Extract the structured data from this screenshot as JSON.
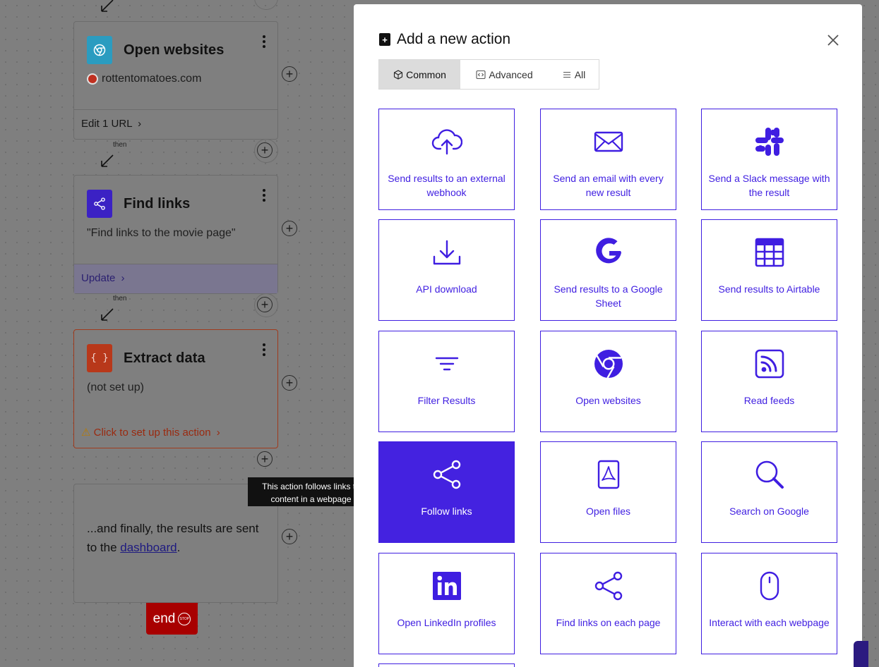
{
  "canvas": {
    "cards": [
      {
        "title": "Open websites",
        "subtitle": "rottentomatoes.com",
        "footer": "Edit 1 URL",
        "badge_color": "#2b9cc0"
      },
      {
        "title": "Find links",
        "subtitle": "\"Find links to the movie page\"",
        "footer": "Update",
        "badge_color": "#3b21c4"
      },
      {
        "title": "Extract data",
        "subtitle": "(not set up)",
        "footer": "Click to set up this action",
        "badge_color": "#b8381a",
        "badge_glyph": "{ }"
      }
    ],
    "then_label": "then",
    "final_text_before": "...and finally, the results are sent to the ",
    "final_link": "dashboard",
    "final_text_after": ".",
    "end_label": "end",
    "stop_label": "STOP",
    "tooltip": "This action follows links to content in a webpage"
  },
  "modal": {
    "title": "Add a new action",
    "plus_glyph": "+",
    "tabs": [
      {
        "label": "Common",
        "active": true
      },
      {
        "label": "Advanced",
        "active": false
      },
      {
        "label": "All",
        "active": false
      }
    ],
    "accent_color": "#3f1ee1",
    "actions": [
      {
        "label": "Send results to an external webhook",
        "icon": "cloud-upload-icon"
      },
      {
        "label": "Send an email with every new result",
        "icon": "mail-icon"
      },
      {
        "label": "Send a Slack message with the result",
        "icon": "slack-icon"
      },
      {
        "label": "API download",
        "icon": "download-icon"
      },
      {
        "label": "Send results to a Google Sheet",
        "icon": "google-icon"
      },
      {
        "label": "Send results to Airtable",
        "icon": "table-grid-icon"
      },
      {
        "label": "Filter Results",
        "icon": "filter-icon"
      },
      {
        "label": "Open websites",
        "icon": "chrome-icon"
      },
      {
        "label": "Read feeds",
        "icon": "rss-icon"
      },
      {
        "label": "Follow links",
        "icon": "share-icon",
        "selected": true
      },
      {
        "label": "Open files",
        "icon": "pdf-file-icon"
      },
      {
        "label": "Search on Google",
        "icon": "magnifier-icon"
      },
      {
        "label": "Open LinkedIn profiles",
        "icon": "linkedin-icon"
      },
      {
        "label": "Find links on each page",
        "icon": "share-icon"
      },
      {
        "label": "Interact with each webpage",
        "icon": "mouse-icon"
      }
    ]
  }
}
